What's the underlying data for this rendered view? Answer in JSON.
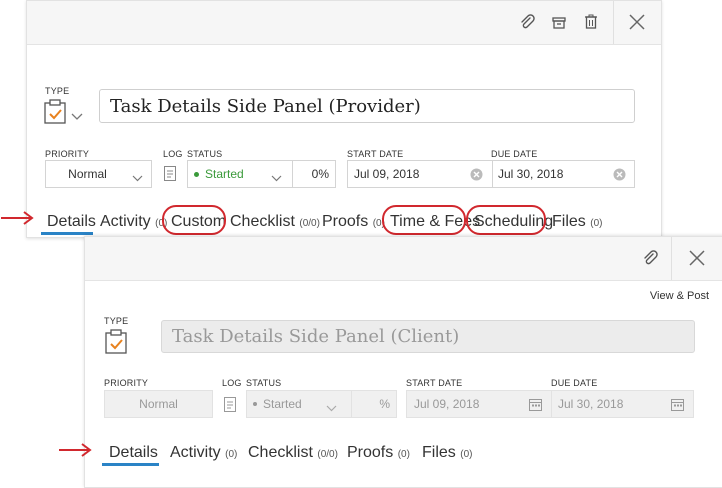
{
  "provider": {
    "type_label": "TYPE",
    "title": "Task Details Side Panel (Provider)",
    "priority_label": "PRIORITY",
    "priority_value": "Normal",
    "log_label": "LOG",
    "status_label": "STATUS",
    "status_value": "Started",
    "percent_value": "0%",
    "start_date_label": "START DATE",
    "start_date_value": "Jul 09, 2018",
    "due_date_label": "DUE DATE",
    "due_date_value": "Jul 30, 2018",
    "tabs": [
      {
        "label": "Details",
        "count": ""
      },
      {
        "label": "Activity",
        "count": "(0)"
      },
      {
        "label": "Custom",
        "count": ""
      },
      {
        "label": "Checklist",
        "count": "(0/0)"
      },
      {
        "label": "Proofs",
        "count": "(0)"
      },
      {
        "label": "Time & Fees",
        "count": ""
      },
      {
        "label": "Scheduling",
        "count": ""
      },
      {
        "label": "Files",
        "count": "(0)"
      }
    ],
    "toolbar_icons": [
      "paperclip-icon",
      "archive-icon",
      "trash-icon",
      "close-icon"
    ]
  },
  "client": {
    "view_post": "View & Post",
    "type_label": "TYPE",
    "title": "Task Details Side Panel (Client)",
    "priority_label": "PRIORITY",
    "priority_value": "Normal",
    "log_label": "LOG",
    "status_label": "STATUS",
    "status_value": "Started",
    "percent_value": "%",
    "start_date_label": "START DATE",
    "start_date_value": "Jul 09, 2018",
    "due_date_label": "DUE DATE",
    "due_date_value": "Jul 30, 2018",
    "tabs": [
      {
        "label": "Details",
        "count": ""
      },
      {
        "label": "Activity",
        "count": "(0)"
      },
      {
        "label": "Checklist",
        "count": "(0/0)"
      },
      {
        "label": "Proofs",
        "count": "(0)"
      },
      {
        "label": "Files",
        "count": "(0)"
      }
    ],
    "toolbar_icons": [
      "paperclip-icon",
      "close-icon"
    ]
  },
  "colors": {
    "accent": "#2a83c6",
    "annotation_red": "#d1282e",
    "status_green": "#3a9a3a",
    "type_icon_orange": "#e8821e"
  }
}
